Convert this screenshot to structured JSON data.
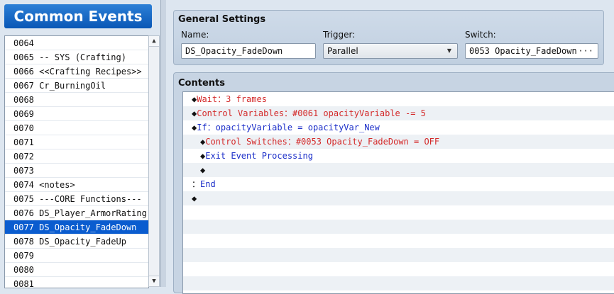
{
  "common_events_title": "Common Events",
  "events": [
    {
      "label": "0064",
      "selected": false
    },
    {
      "label": "0065 -- SYS (Crafting)",
      "selected": false
    },
    {
      "label": "0066 <<Crafting Recipes>>",
      "selected": false
    },
    {
      "label": "0067 Cr_BurningOil",
      "selected": false
    },
    {
      "label": "0068",
      "selected": false
    },
    {
      "label": "0069",
      "selected": false
    },
    {
      "label": "0070",
      "selected": false
    },
    {
      "label": "0071",
      "selected": false
    },
    {
      "label": "0072",
      "selected": false
    },
    {
      "label": "0073",
      "selected": false
    },
    {
      "label": "0074 <notes>",
      "selected": false
    },
    {
      "label": "0075 ---CORE Functions---",
      "selected": false
    },
    {
      "label": "0076 DS_Player_ArmorRating",
      "selected": false
    },
    {
      "label": "0077 DS_Opacity_FadeDown",
      "selected": true
    },
    {
      "label": "0078 DS_Opacity_FadeUp",
      "selected": false
    },
    {
      "label": "0079",
      "selected": false
    },
    {
      "label": "0080",
      "selected": false
    },
    {
      "label": "0081",
      "selected": false
    }
  ],
  "general_settings": {
    "title": "General Settings",
    "name_label": "Name:",
    "name_value": "DS_Opacity_FadeDown",
    "trigger_label": "Trigger:",
    "trigger_value": "Parallel",
    "switch_label": "Switch:",
    "switch_value": "0053 Opacity_FadeDown",
    "switch_button": "···"
  },
  "contents": {
    "title": "Contents",
    "commands": [
      {
        "indent": 0,
        "prefix": "◆",
        "text": "Wait：3 frames",
        "color": "red"
      },
      {
        "indent": 0,
        "prefix": "◆",
        "text": "Control Variables：#0061 opacityVariable -= 5",
        "color": "red"
      },
      {
        "indent": 0,
        "prefix": "◆",
        "text": "If：opacityVariable = opacityVar_New",
        "color": "blue"
      },
      {
        "indent": 1,
        "prefix": "◆",
        "text": "Control Switches：#0053 Opacity_FadeDown = OFF",
        "color": "red"
      },
      {
        "indent": 1,
        "prefix": "◆",
        "text": "Exit Event Processing",
        "color": "blue"
      },
      {
        "indent": 1,
        "prefix": "◆",
        "text": "",
        "color": "none"
      },
      {
        "indent": 0,
        "prefix": "：",
        "text": "End",
        "color": "blue"
      },
      {
        "indent": 0,
        "prefix": "◆",
        "text": "",
        "color": "none"
      }
    ],
    "blank_rows": 6
  },
  "colors": {
    "red": "#d42a2a",
    "blue": "#1c2fc9",
    "selection": "#0a5ccf"
  }
}
